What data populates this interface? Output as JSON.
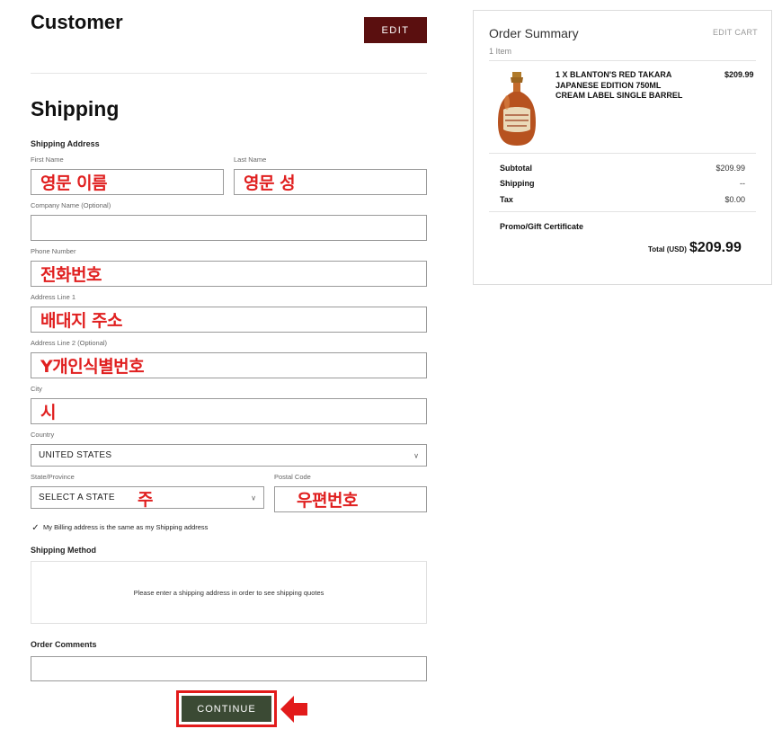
{
  "customer": {
    "title": "Customer",
    "edit_label": "EDIT"
  },
  "shipping": {
    "title": "Shipping",
    "address_heading": "Shipping Address",
    "first_name": {
      "label": "First Name",
      "value": "영문 이름"
    },
    "last_name": {
      "label": "Last Name",
      "value": "영문 성"
    },
    "company": {
      "label": "Company Name (Optional)",
      "value": ""
    },
    "phone": {
      "label": "Phone Number",
      "value": "전화번호"
    },
    "address1": {
      "label": "Address Line 1",
      "value": "배대지 주소"
    },
    "address2": {
      "label": "Address Line 2 (Optional)",
      "value": "Y개인식별번호"
    },
    "city": {
      "label": "City",
      "value": "시"
    },
    "country": {
      "label": "Country",
      "value": "UNITED STATES"
    },
    "state": {
      "label": "State/Province",
      "value": "SELECT A STATE",
      "annotation": "주"
    },
    "postal": {
      "label": "Postal Code",
      "value": "우편번호"
    },
    "billing_same": {
      "label": "My Billing address is the same as my Shipping address",
      "checked": true
    },
    "method_heading": "Shipping Method",
    "method_note": "Please enter a shipping address in order to see shipping quotes",
    "comments_heading": "Order Comments",
    "comments_value": "",
    "continue_label": "CONTINUE"
  },
  "summary": {
    "title": "Order Summary",
    "count": "1 Item",
    "edit_cart": "EDIT CART",
    "item": {
      "name_lines": [
        "1 X BLANTON'S RED TAKARA",
        "JAPANESE EDITION 750ML",
        "CREAM LABEL SINGLE BARREL"
      ],
      "price": "$209.99",
      "image": "whiskey-bottle"
    },
    "subtotal_label": "Subtotal",
    "subtotal_value": "$209.99",
    "shipping_label": "Shipping",
    "shipping_value": "--",
    "tax_label": "Tax",
    "tax_value": "$0.00",
    "promo_label": "Promo/Gift Certificate",
    "total_label": "Total (USD)",
    "total_value": "$209.99"
  },
  "colors": {
    "edit_button": "#5a0f0f",
    "continue_button": "#3b4a34",
    "annotation_red": "#e02020"
  }
}
